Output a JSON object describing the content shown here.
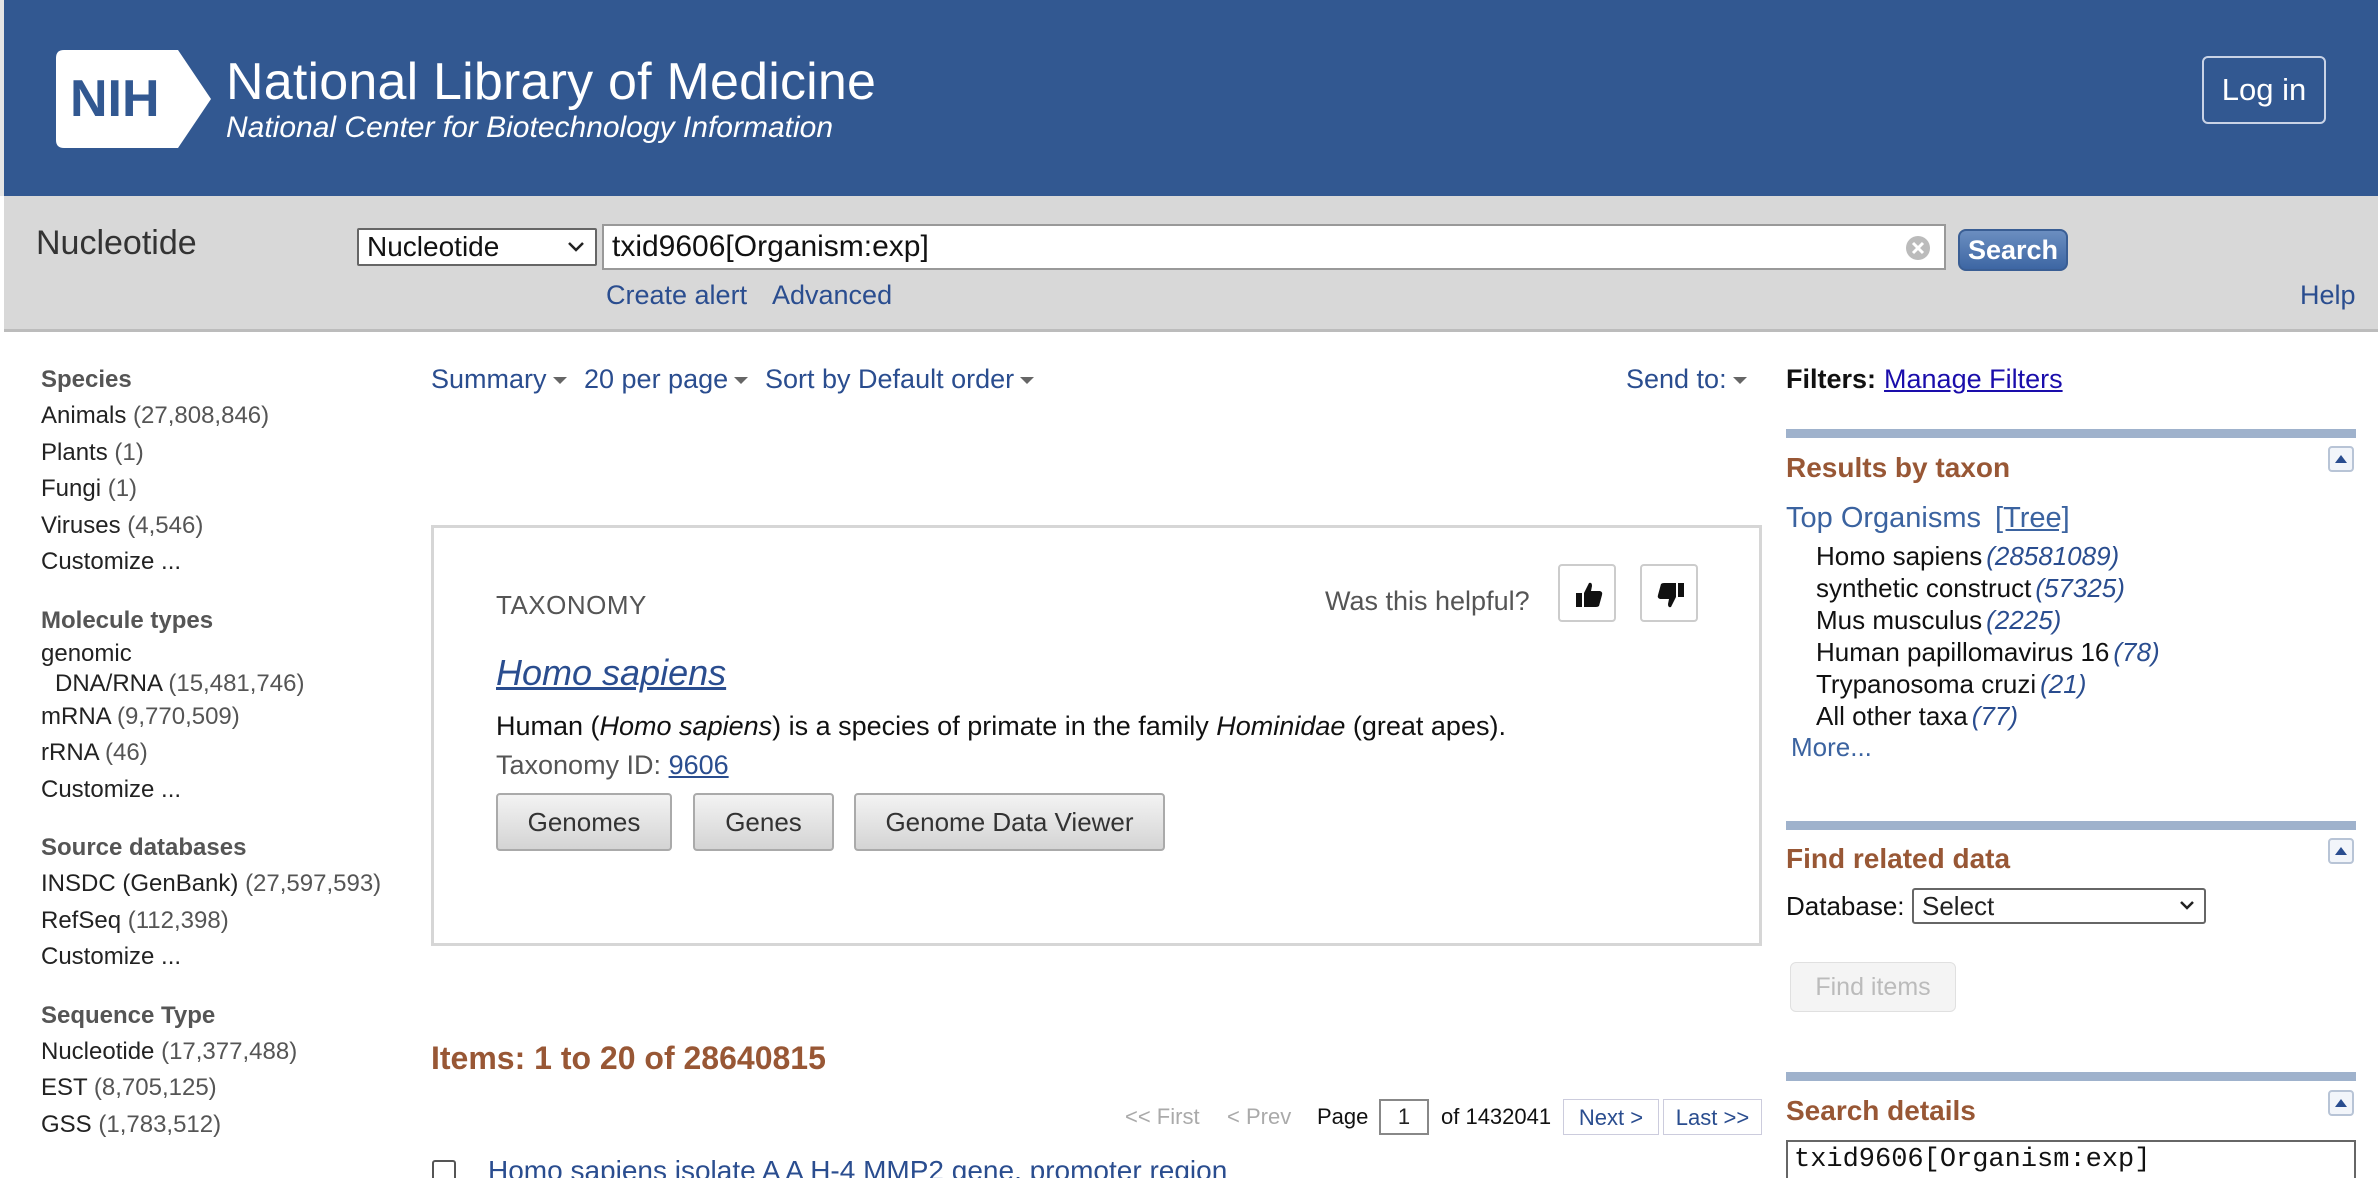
{
  "header": {
    "logo_text": "NIH",
    "title": "National Library of Medicine",
    "subtitle": "National Center for Biotechnology Information",
    "login_label": "Log in"
  },
  "search": {
    "db_name": "Nucleotide",
    "db_select_value": "Nucleotide",
    "query": "txid9606[Organism:exp]",
    "search_label": "Search",
    "create_alert": "Create alert",
    "advanced": "Advanced",
    "help": "Help"
  },
  "facets": {
    "species": {
      "title": "Species",
      "items": [
        {
          "label": "Animals",
          "count": "(27,808,846)"
        },
        {
          "label": "Plants",
          "count": "(1)"
        },
        {
          "label": "Fungi",
          "count": "(1)"
        },
        {
          "label": "Viruses",
          "count": "(4,546)"
        }
      ],
      "customize": "Customize ..."
    },
    "molecule": {
      "title": "Molecule types",
      "genomic_line1": "genomic",
      "genomic_line2": "DNA/RNA",
      "genomic_count": "(15,481,746)",
      "items": [
        {
          "label": "mRNA",
          "count": "(9,770,509)"
        },
        {
          "label": "rRNA",
          "count": "(46)"
        }
      ],
      "customize": "Customize ..."
    },
    "source": {
      "title": "Source databases",
      "items": [
        {
          "label": "INSDC (GenBank)",
          "count": "(27,597,593)"
        },
        {
          "label": "RefSeq",
          "count": "(112,398)"
        }
      ],
      "customize": "Customize ..."
    },
    "seqtype": {
      "title": "Sequence Type",
      "items": [
        {
          "label": "Nucleotide",
          "count": "(17,377,488)"
        },
        {
          "label": "EST",
          "count": "(8,705,125)"
        },
        {
          "label": "GSS",
          "count": "(1,783,512)"
        }
      ]
    }
  },
  "display": {
    "summary": "Summary",
    "per_page": "20 per page",
    "sort": "Sort by Default order",
    "send_to": "Send to:"
  },
  "taxonomy": {
    "label": "TAXONOMY",
    "helpful": "Was this helpful?",
    "title": "Homo sapiens",
    "desc_1": "Human (",
    "desc_2": "Homo sapiens",
    "desc_3": ") is a species of primate in the family ",
    "desc_4": "Hominidae",
    "desc_5": " (great apes).",
    "id_label": "Taxonomy ID: ",
    "id_value": "9606",
    "buttons": [
      "Genomes",
      "Genes",
      "Genome Data Viewer"
    ]
  },
  "results": {
    "items_count": "Items: 1 to 20 of 28640815",
    "pager": {
      "first": "<< First",
      "prev": "< Prev",
      "page_label": "Page",
      "page_value": "1",
      "of_label": "of 1432041",
      "next": "Next >",
      "last": "Last >>"
    },
    "first_result": "Homo sapiens isolate A A H-4 MMP2 gene, promoter region"
  },
  "sidebar": {
    "filters_label": "Filters:",
    "manage_filters": "Manage Filters",
    "taxon": {
      "title": "Results by taxon",
      "top_organisms": "Top Organisms",
      "tree": "[Tree]",
      "organisms": [
        {
          "name": "Homo sapiens",
          "count": "(28581089)"
        },
        {
          "name": "synthetic construct",
          "count": "(57325)"
        },
        {
          "name": "Mus musculus",
          "count": "(2225)"
        },
        {
          "name": "Human papillomavirus 16",
          "count": "(78)"
        },
        {
          "name": "Trypanosoma cruzi",
          "count": "(21)"
        },
        {
          "name": "All other taxa",
          "count": "(77)"
        }
      ],
      "more": "More..."
    },
    "related": {
      "title": "Find related data",
      "db_label": "Database:",
      "db_value": "Select",
      "find_items": "Find items"
    },
    "details": {
      "title": "Search details",
      "query": "txid9606[Organism:exp]"
    }
  },
  "colors": {
    "header_bg": "#325891",
    "link": "#2a4d8f",
    "section_title": "#985735"
  }
}
